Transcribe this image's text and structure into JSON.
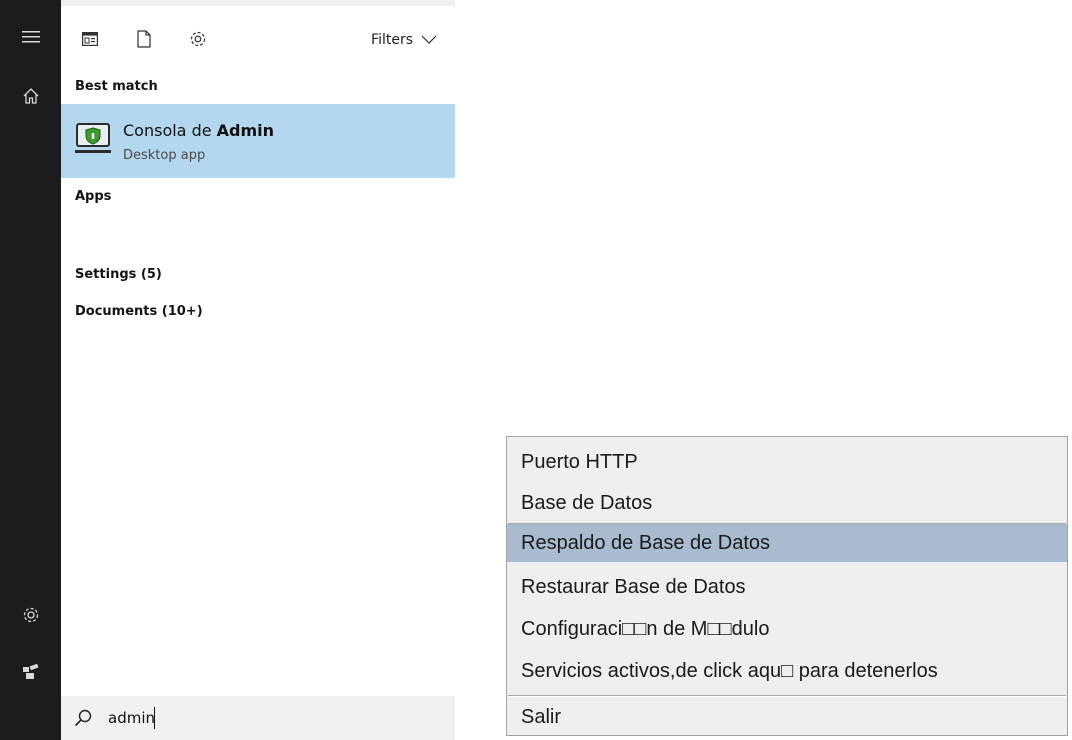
{
  "start_menu": {
    "rail": {
      "icons": [
        "hamburger-menu-icon",
        "home-icon",
        "settings-icon",
        "user-icon"
      ]
    },
    "toolbar": {
      "icons": [
        "all-apps-icon",
        "documents-icon",
        "settings-icon"
      ],
      "filters_label": "Filters"
    },
    "sections": {
      "best_match": "Best match",
      "apps": "Apps",
      "settings": "Settings (5)",
      "documents": "Documents (10+)"
    },
    "best_match_result": {
      "title_prefix": "Consola de ",
      "title_bold": "Admin",
      "subtitle": "Desktop app",
      "icon": "admin-console-shield-icon"
    },
    "search": {
      "value": "admin",
      "icon": "search-icon"
    }
  },
  "context_menu": {
    "items": [
      {
        "label": "Puerto HTTP"
      },
      {
        "label": "Base de Datos"
      },
      {
        "label": "Respaldo de Base de Datos"
      },
      {
        "label": "Restaurar Base de Datos"
      },
      {
        "label": "Configuraci□□n de M□□dulo"
      },
      {
        "label": "Servicios activos,de click aqu□ para detenerlos"
      },
      {
        "label": "Salir"
      }
    ]
  },
  "colors": {
    "rail_bg": "#1b1b1b",
    "highlight": "#b3d7ee",
    "menu_selected": "#a9bccf",
    "menu_bg": "#efefef"
  }
}
